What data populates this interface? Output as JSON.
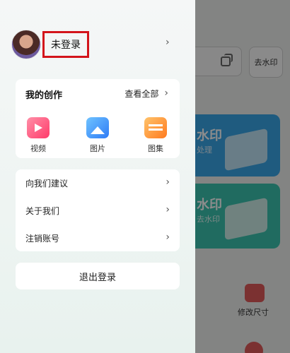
{
  "drawer": {
    "login_label": "未登录",
    "creations": {
      "title": "我的创作",
      "view_all": "查看全部",
      "items": [
        {
          "label": "视频",
          "icon": "video-icon"
        },
        {
          "label": "图片",
          "icon": "image-icon"
        },
        {
          "label": "图集",
          "icon": "album-icon"
        }
      ]
    },
    "menu": [
      {
        "label": "向我们建议"
      },
      {
        "label": "关于我们"
      },
      {
        "label": "注销账号"
      }
    ],
    "logout_label": "退出登录",
    "highlight_color": "#d3141b"
  },
  "background_app": {
    "remove_button": "去水印",
    "card1_title": "水印",
    "card1_sub": "处理",
    "card2_title": "水印",
    "card2_sub": "去水印",
    "tool_label": "修改尺寸"
  }
}
